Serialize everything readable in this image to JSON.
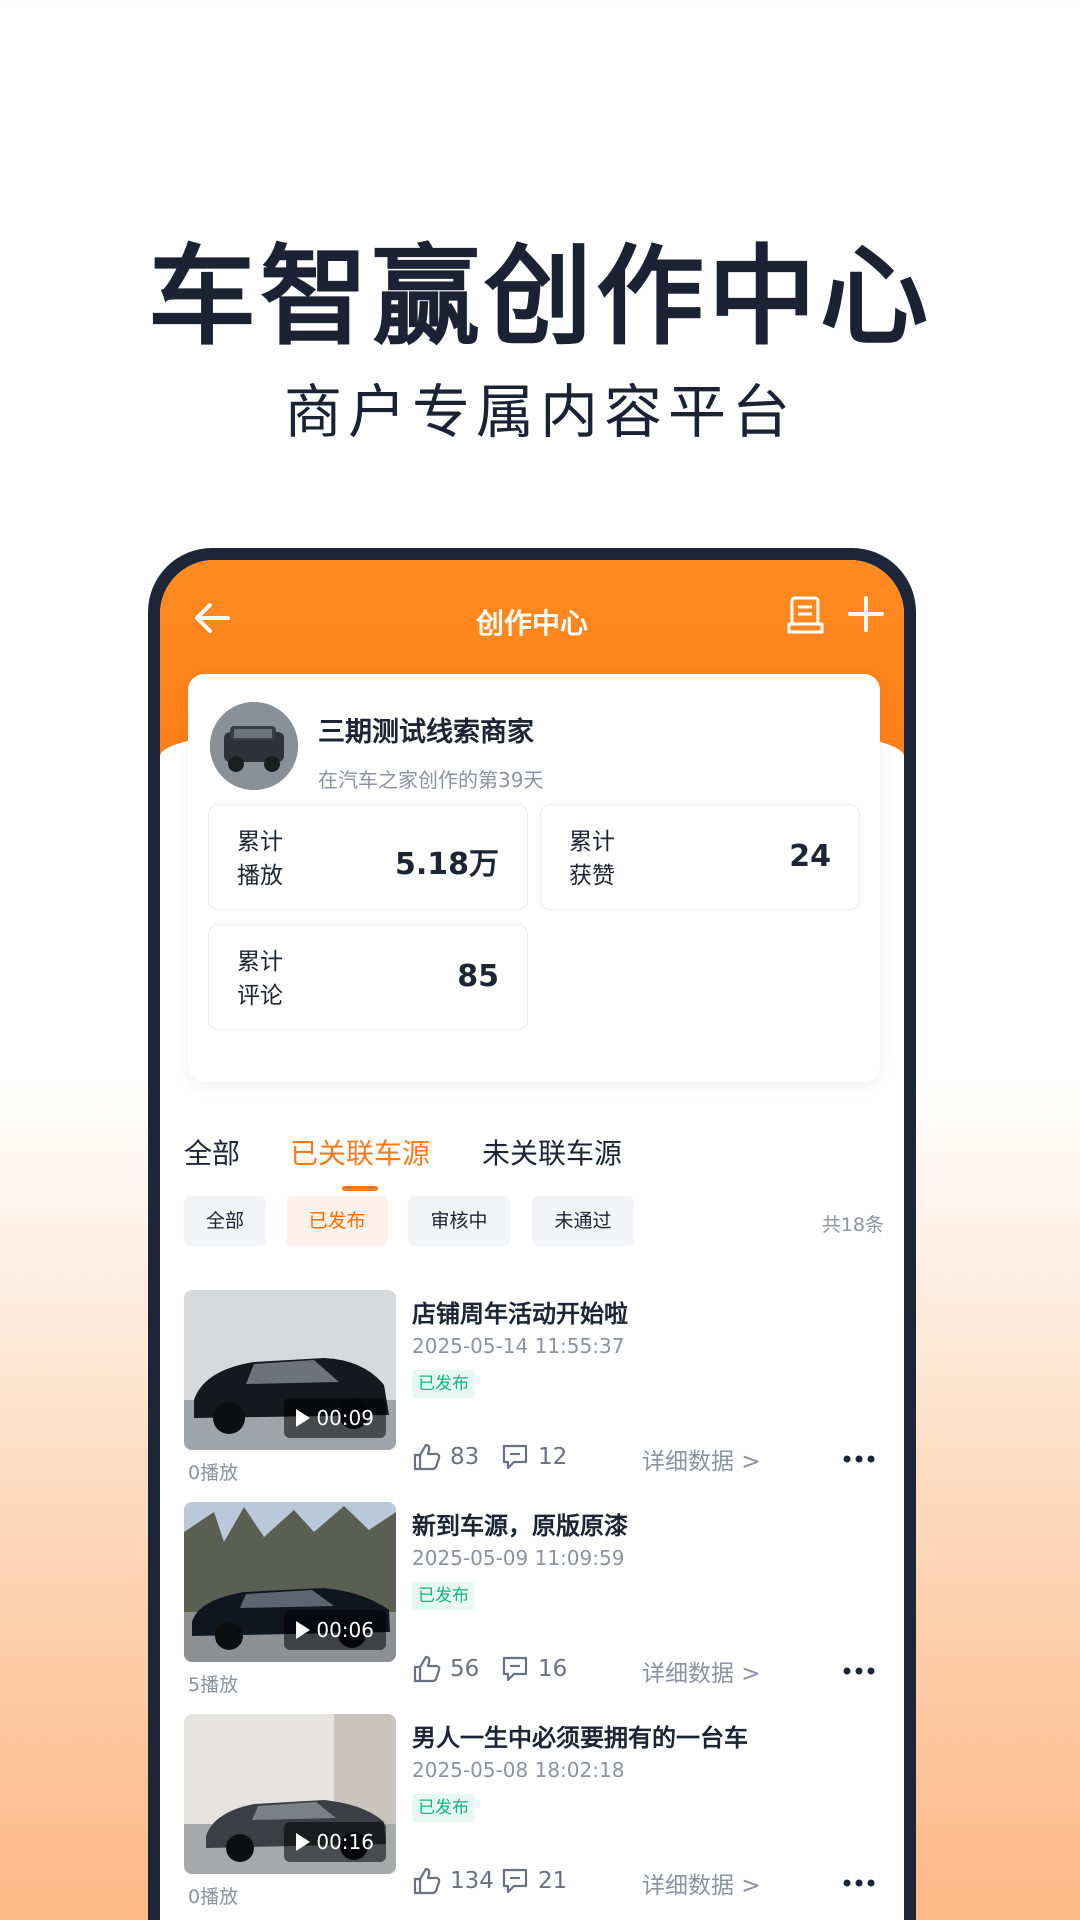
{
  "promo": {
    "title": "车智赢创作中心",
    "subtitle": "商户专属内容平台"
  },
  "header": {
    "title": "创作中心",
    "back_icon": "arrow-left-icon",
    "draft_icon": "draft-box-icon",
    "add_icon": "plus-icon"
  },
  "profile": {
    "name": "三期测试线索商家",
    "days": "在汽车之家创作的第39天"
  },
  "stats": [
    {
      "label": "累计播放",
      "value": "5.18万"
    },
    {
      "label": "累计获赞",
      "value": "24"
    },
    {
      "label": "累计评论",
      "value": "85"
    }
  ],
  "tabs": [
    {
      "label": "全部"
    },
    {
      "label": "已关联车源",
      "active": true
    },
    {
      "label": "未关联车源"
    }
  ],
  "filters": [
    {
      "label": "全部"
    },
    {
      "label": "已发布",
      "active": true
    },
    {
      "label": "审核中"
    },
    {
      "label": "未通过"
    }
  ],
  "total": "共18条",
  "videos": [
    {
      "title": "店铺周年活动开始啦",
      "time": "2025-05-14 11:55:37",
      "status": "已发布",
      "duration": "00:09",
      "plays": "0播放",
      "likes": "83",
      "comments": "12",
      "detail": "详细数据 >"
    },
    {
      "title": "新到车源，原版原漆",
      "time": "2025-05-09 11:09:59",
      "status": "已发布",
      "duration": "00:06",
      "plays": "5播放",
      "likes": "56",
      "comments": "16",
      "detail": "详细数据 >"
    },
    {
      "title": "男人一生中必须要拥有的一台车",
      "time": "2025-05-08 18:02:18",
      "status": "已发布",
      "duration": "00:16",
      "plays": "0播放",
      "likes": "134",
      "comments": "21",
      "detail": "详细数据 >"
    }
  ],
  "colors": {
    "accent": "#ff7a1a",
    "header": "#ff8a1f",
    "success": "#18b37c"
  }
}
